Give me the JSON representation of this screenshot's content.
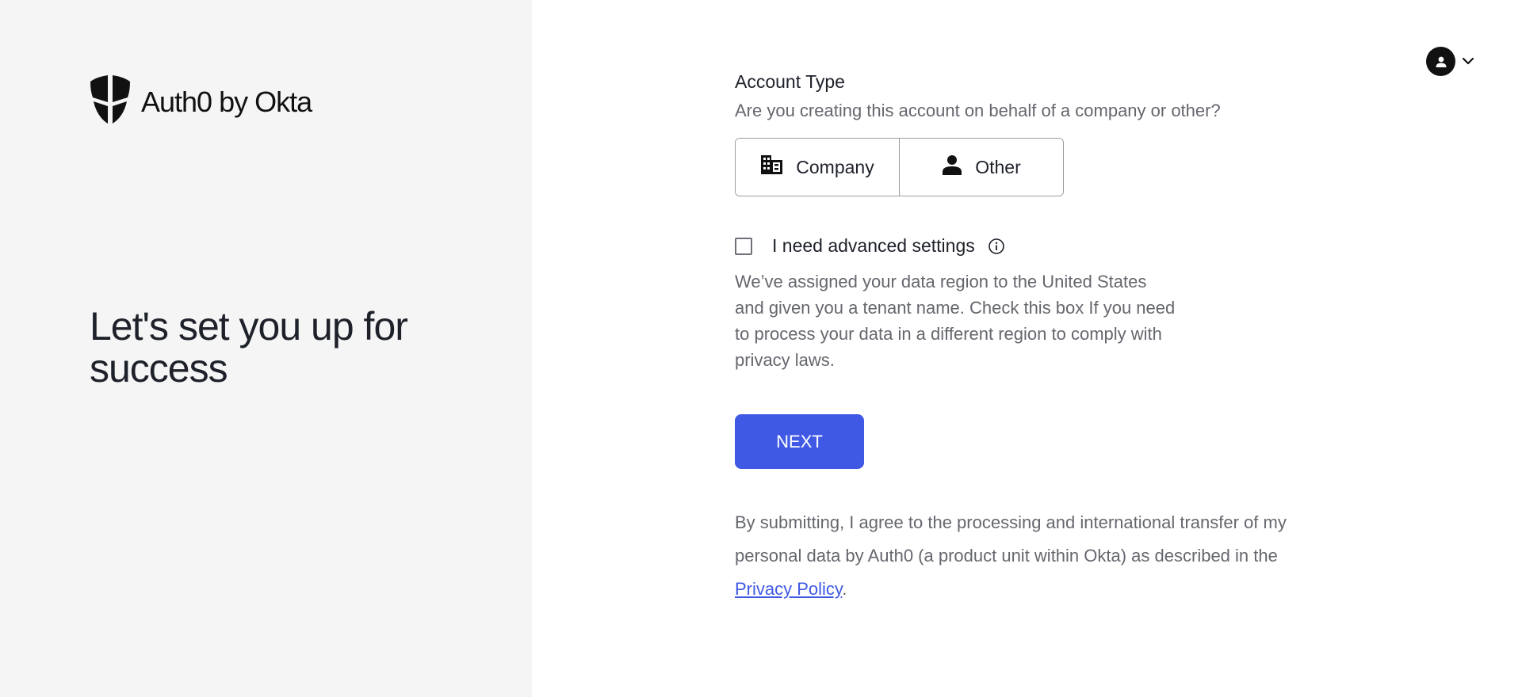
{
  "brand": {
    "logo_text": "Auth0 by Okta"
  },
  "left_panel": {
    "headline": "Let's set you up for success"
  },
  "user_menu": {
    "icon": "user-avatar-icon",
    "chevron": "chevron-down-icon"
  },
  "account_type": {
    "title": "Account Type",
    "subtitle": "Are you creating this account on behalf of a company or other?",
    "options": [
      {
        "label": "Company",
        "icon": "building-icon"
      },
      {
        "label": "Other",
        "icon": "person-icon"
      }
    ]
  },
  "advanced": {
    "checkbox_checked": false,
    "label": "I need advanced settings",
    "help_text": "We’ve assigned your data region to the United States and given you a tenant name. Check this box If you need to process your data in a different region to comply with privacy laws."
  },
  "next_button": {
    "label": "NEXT"
  },
  "legal": {
    "text": "By submitting, I agree to the processing and international transfer of my personal data by Auth0 (a product unit within Okta) as described in the ",
    "link_text": "Privacy Policy",
    "suffix": "."
  },
  "colors": {
    "accent": "#3f59e4",
    "left_panel_bg": "#f5f5f5",
    "text_primary": "#1e212a",
    "text_secondary": "#65676e"
  }
}
